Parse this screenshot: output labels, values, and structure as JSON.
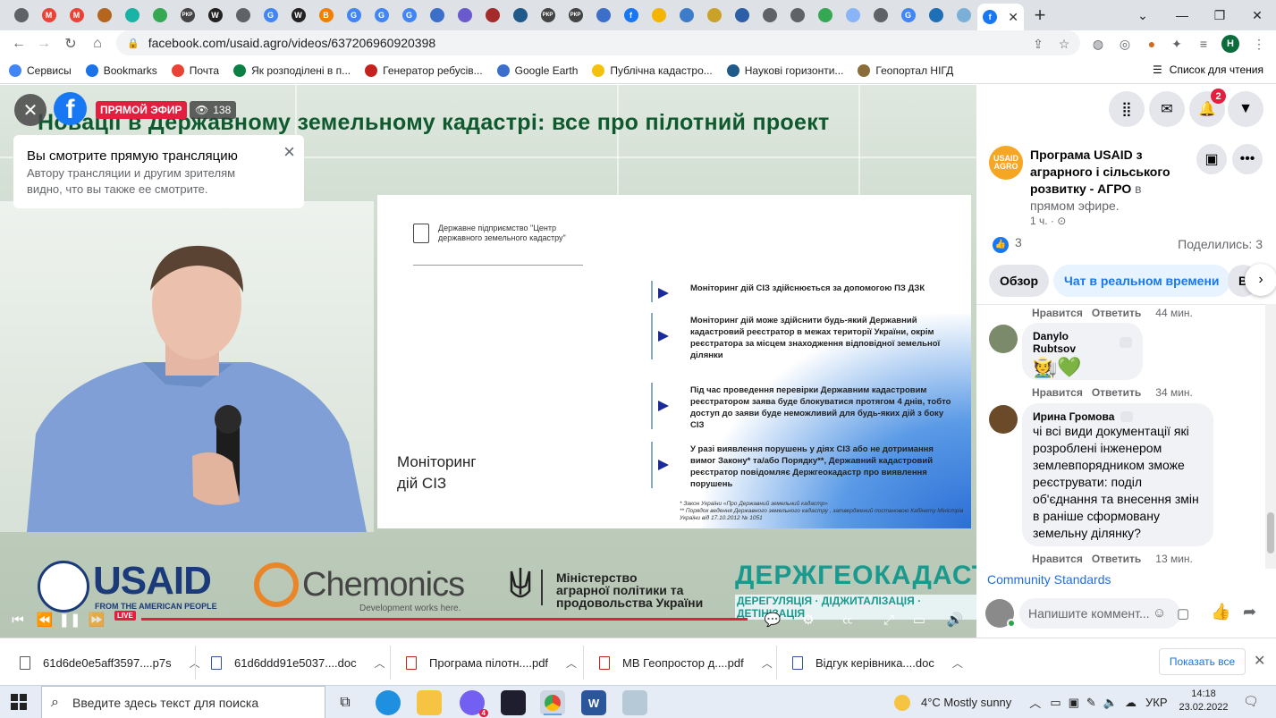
{
  "browser": {
    "tabs": [
      {
        "icon": "globe-icon",
        "color": "#5f6368",
        "glyph": ""
      },
      {
        "icon": "gmail-icon",
        "color": "#ea4335",
        "glyph": "M"
      },
      {
        "icon": "gmail-icon",
        "color": "#ea4335",
        "glyph": "M"
      },
      {
        "icon": "emblem-icon",
        "color": "#b5651d",
        "glyph": ""
      },
      {
        "icon": "app-icon",
        "color": "#19b3a6",
        "glyph": ""
      },
      {
        "icon": "maps-icon",
        "color": "#34a853",
        "glyph": ""
      },
      {
        "icon": "rkr-icon",
        "color": "#444444",
        "glyph": "РКР"
      },
      {
        "icon": "wikipedia-icon",
        "color": "#222222",
        "glyph": "W"
      },
      {
        "icon": "globe-icon",
        "color": "#5f6368",
        "glyph": ""
      },
      {
        "icon": "google-icon",
        "color": "#4285f4",
        "glyph": "G"
      },
      {
        "icon": "wikipedia-icon",
        "color": "#222222",
        "glyph": "W"
      },
      {
        "icon": "blogger-icon",
        "color": "#f57d00",
        "glyph": "B"
      },
      {
        "icon": "google-icon",
        "color": "#4285f4",
        "glyph": "G"
      },
      {
        "icon": "google-icon",
        "color": "#4285f4",
        "glyph": "G"
      },
      {
        "icon": "google-icon",
        "color": "#4285f4",
        "glyph": "G"
      },
      {
        "icon": "earth-icon",
        "color": "#3b6fc9",
        "glyph": ""
      },
      {
        "icon": "site-icon",
        "color": "#6a5acd",
        "glyph": ""
      },
      {
        "icon": "coat-of-arms-icon",
        "color": "#a52a2a",
        "glyph": ""
      },
      {
        "icon": "site-icon",
        "color": "#1f5a8a",
        "glyph": ""
      },
      {
        "icon": "rkr-icon",
        "color": "#444444",
        "glyph": "РКР"
      },
      {
        "icon": "rkr-icon",
        "color": "#444444",
        "glyph": "РКР"
      },
      {
        "icon": "earth-icon",
        "color": "#3b6fc9",
        "glyph": ""
      },
      {
        "icon": "facebook-icon",
        "color": "#1877f2",
        "glyph": "f"
      },
      {
        "icon": "star-icon",
        "color": "#f4b400",
        "glyph": ""
      },
      {
        "icon": "site-icon",
        "color": "#3d7cc9",
        "glyph": ""
      },
      {
        "icon": "emblem-icon",
        "color": "#c9a227",
        "glyph": ""
      },
      {
        "icon": "pen-icon",
        "color": "#2d5fa8",
        "glyph": ""
      },
      {
        "icon": "globe-icon",
        "color": "#5f6368",
        "glyph": ""
      },
      {
        "icon": "globe-icon",
        "color": "#5f6368",
        "glyph": ""
      },
      {
        "icon": "maps-icon",
        "color": "#34a853",
        "glyph": ""
      },
      {
        "icon": "doc-icon",
        "color": "#8ab4f8",
        "glyph": ""
      },
      {
        "icon": "globe-icon",
        "color": "#5f6368",
        "glyph": ""
      },
      {
        "icon": "google-icon",
        "color": "#4285f4",
        "glyph": "G"
      },
      {
        "icon": "edge-icon",
        "color": "#1d6fb8",
        "glyph": ""
      },
      {
        "icon": "cloud-icon",
        "color": "#7ab0d8",
        "glyph": ""
      }
    ],
    "active_tab": {
      "icon": "facebook-icon",
      "color": "#1877f2",
      "glyph": "f",
      "close": "✕"
    },
    "new_tab": "+",
    "window_controls": [
      "⌄",
      "—",
      "❐",
      "✕"
    ],
    "url": "facebook.com/usaid.agro/videos/637206960920398",
    "profile_initial": "Н",
    "bookmarks": [
      {
        "label": "Сервисы",
        "icon": "apps-icon",
        "color": "#4285f4"
      },
      {
        "label": "Bookmarks",
        "icon": "star-icon",
        "color": "#1a73e8"
      },
      {
        "label": "Почта",
        "icon": "gmail-icon",
        "color": "#ea4335"
      },
      {
        "label": "Як розподілені в п...",
        "icon": "triangle-icon",
        "color": "#0b8043"
      },
      {
        "label": "Генератор ребусів...",
        "icon": "site-icon",
        "color": "#c5221f"
      },
      {
        "label": "Google Earth",
        "icon": "earth-icon",
        "color": "#3b6fc9"
      },
      {
        "label": "Публічна кадастро...",
        "icon": "flag-icon",
        "color": "#f4c20d"
      },
      {
        "label": "Наукові горизонти...",
        "icon": "site-icon",
        "color": "#1f5a8a"
      },
      {
        "label": "Геопортал НІГД",
        "icon": "emblem-icon",
        "color": "#8a6d3b"
      }
    ],
    "reading_list": "Список для чтения"
  },
  "video": {
    "title": "Новації в Державному земельному кадастрі: все про пілотний проект",
    "live_label": "ПРЯМОЙ ЭФИР",
    "viewers": "138",
    "notice": {
      "title": "Вы смотрите прямую трансляцию",
      "body": "Автору трансляции и другим зрителям видно, что вы также ее смотрите."
    },
    "slide": {
      "org": "Державне підприємство \"Центр\nдержавного земельного кадастру\"",
      "bullets": [
        "Моніторинг дій СІЗ здійснюється за допомогою ПЗ ДЗК",
        "Моніторинг дій може здійснити будь-який Державний кадастровий реєстратор в межах території  України, окрім реєстратора за місцем знаходження відповідної земельної ділянки",
        "Під час проведення перевірки Державним кадастровим реєстратором заява буде блокуватися протягом 4 днів, тобто доступ до заяви буде неможливий для будь-яких дій з боку СІЗ",
        "У разі виявлення порушень у діях СІЗ або не дотримання вимог Закону* та/або Порядку**, Державний кадастровий реєстратор повідомляє Держгеокадастр про виявлення порушень"
      ],
      "heading": "Моніторинг\nдій СІЗ",
      "footnote": "*  Закон України «Про Державний земельний кадастр»\n** Порядок ведення Державного земельного кадастру , затверджений постановою Кабінету Міністрів України від 17.10.2012 № 1051"
    },
    "logos": {
      "usaid": "USAID",
      "usaid_sub": "FROM THE AMERICAN PEOPLE",
      "chemonics": "Chemonics",
      "chemonics_sub": "Development works here.",
      "ministry": "Міністерство\nаграрної політики та\nпродовольства України",
      "dzk": "ДЕРЖГЕОКАДАСТР",
      "dzk_sub": "ДЕРЕГУЛЯЦІЯ · ДІДЖИТАЛІЗАЦІЯ · ДЕТІНІЗАЦІЯ"
    },
    "controls": {
      "live": "LIVE",
      "progress": 1.0,
      "accent": "#e41e3f"
    }
  },
  "post": {
    "avatar_text": "USAID\nAGRO",
    "page_name": "Програма USAID з аграрного і сільського розвитку - АГРО",
    "live_suffix": " в прямом эфире.",
    "time": "1 ч. ·",
    "likes": "3",
    "shares": "Поделились: 3",
    "tabs": [
      "Обзор",
      "Чат в реальном времени",
      "В"
    ],
    "notification_count": "2"
  },
  "comments": [
    {
      "actions": [
        "Нравится",
        "Ответить"
      ],
      "time": "44 мин."
    },
    {
      "author": "Danylo Rubtsov",
      "text": "🧑‍🌾💚",
      "actions": [
        "Нравится",
        "Ответить"
      ],
      "time": "34 мин."
    },
    {
      "author": "Ирина Громова",
      "text": "чі всі види документації які розроблені інженером землевпорядником зможе реєструвати: поділ об'єднання та внесення змін в раніше сформовану земельну ділянку?",
      "actions": [
        "Нравится",
        "Ответить"
      ],
      "time": "13 мин."
    }
  ],
  "community_standards": "Community Standards",
  "comment_placeholder": "Напишите коммент...",
  "downloads": [
    {
      "name": "61d6de0e5aff3597....p7s",
      "type": "file"
    },
    {
      "name": "61d6ddd91e5037....doc",
      "type": "word"
    },
    {
      "name": "Програма пілотн....pdf",
      "type": "pdf"
    },
    {
      "name": "МВ Геопростор д....pdf",
      "type": "pdf"
    },
    {
      "name": "Відгук керівника....doc",
      "type": "word"
    }
  ],
  "show_all": "Показать все",
  "taskbar": {
    "search_placeholder": "Введите здесь текст для поиска",
    "viber_badge": "4",
    "weather": "4°C  Mostly sunny",
    "lang": "УКР",
    "time": "14:18",
    "date": "23.02.2022"
  }
}
